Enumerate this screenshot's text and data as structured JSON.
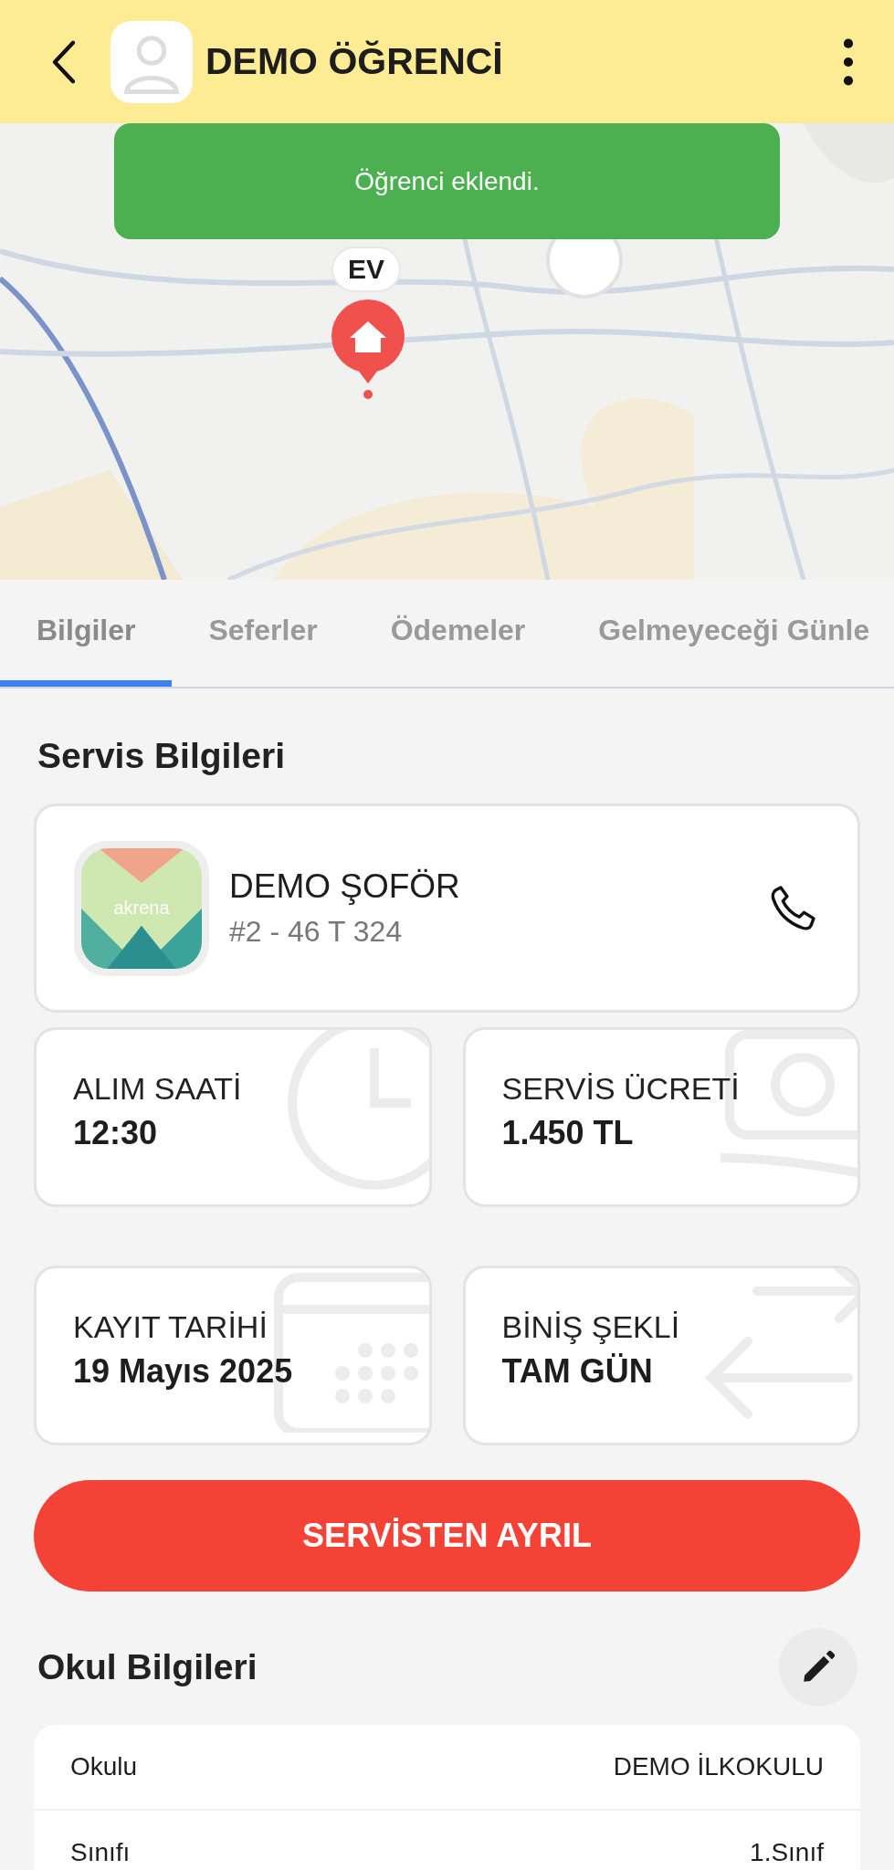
{
  "header": {
    "title": "DEMO ÖĞRENCİ"
  },
  "map": {
    "kind": "picture",
    "marker_label": "EV"
  },
  "toast": {
    "text": "Öğrenci eklendi."
  },
  "tabs": [
    {
      "label": "Bilgiler",
      "selected": true
    },
    {
      "label": "Seferler",
      "selected": false
    },
    {
      "label": "Ödemeler",
      "selected": false
    },
    {
      "label": "Gelmeyeceği Günle",
      "selected": false
    }
  ],
  "service": {
    "title": "Servis Bilgileri",
    "driver": {
      "name": "DEMO ŞOFÖR",
      "plate": "#2 - 46 T 324",
      "logo_text": "akrena"
    },
    "cards": [
      {
        "label": "ALIM SAATİ",
        "value": "12:30"
      },
      {
        "label": "SERVİS ÜCRETİ",
        "value": "1.450 TL"
      },
      {
        "label": "KAYIT TARİHİ",
        "value": "19 Mayıs 2025"
      },
      {
        "label": "BİNİŞ ŞEKLİ",
        "value": "TAM GÜN"
      }
    ],
    "leave_button": "SERVİSTEN AYRIL"
  },
  "school": {
    "title": "Okul Bilgileri",
    "rows": [
      {
        "label": "Okulu",
        "value": "DEMO İLKOKULU"
      },
      {
        "label": "Sınıfı",
        "value": "1.Sınıf"
      }
    ]
  }
}
